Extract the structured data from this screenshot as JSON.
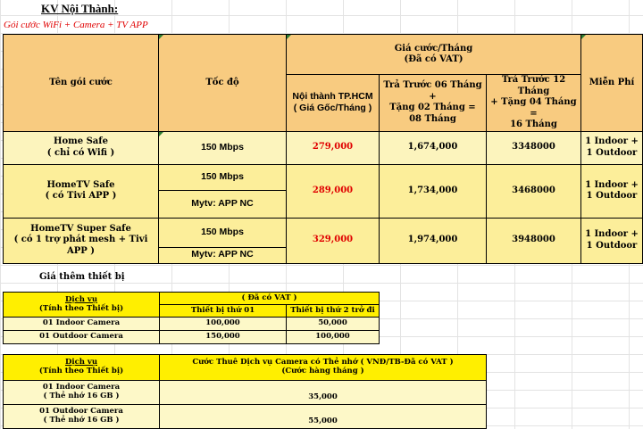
{
  "title": "KV Nội Thành:",
  "subtitle": "Gói cước WiFi + Camera + TV APP",
  "main_table": {
    "headers": {
      "package": "Tên gói cước",
      "speed": "Tốc độ",
      "price_group_line1": "Giá cước/Tháng",
      "price_group_line2": "(Đã có VAT)",
      "col_base_line1": "Nội thành TP.HCM",
      "col_base_line2": "( Giá Gốc/Tháng )",
      "col_6m_line1": "Trả Trước 06 Tháng +",
      "col_6m_line2": "Tặng 02 Tháng =",
      "col_6m_line3": "08 Tháng",
      "col_12m_line1": "Trả Trước 12 Tháng",
      "col_12m_line2": "+ Tặng 04 Tháng =",
      "col_12m_line3": "16 Tháng",
      "free": "Miễn Phí"
    },
    "rows": [
      {
        "name_line1": "Home Safe",
        "name_line2": "( chỉ có Wifi )",
        "speed": "150 Mbps",
        "tv": "",
        "base_price": "279,000",
        "prepay_6": "1,674,000",
        "prepay_12": "3348000",
        "free_line1": "1 Indoor +",
        "free_line2": "1 Outdoor"
      },
      {
        "name_line1": "HomeTV Safe",
        "name_line2": "( có Tivi APP )",
        "speed": "150 Mbps",
        "tv": "Mytv: APP NC",
        "base_price": "289,000",
        "prepay_6": "1,734,000",
        "prepay_12": "3468000",
        "free_line1": "1 Indoor +",
        "free_line2": "1 Outdoor"
      },
      {
        "name_line1": "HomeTV Super Safe",
        "name_line2": "( có 1 trợ phát mesh + Tivi APP )",
        "speed": "150 Mbps",
        "tv": "Mytv: APP NC",
        "base_price": "329,000",
        "prepay_6": "1,974,000",
        "prepay_12": "3948000",
        "free_line1": "1 Indoor +",
        "free_line2": "1 Outdoor"
      }
    ]
  },
  "extra_label": "Giá thêm thiết bị",
  "device_table": {
    "service_line1": "Dịch vụ",
    "service_line2": "(Tính theo Thiết bị)",
    "vat": "( Đã có VAT )",
    "first": "Thiết bị thứ 01",
    "second": "Thiết bị thứ 2 trở đi",
    "rows": [
      {
        "name": "01 Indoor Camera",
        "first": "100,000",
        "second": "50,000"
      },
      {
        "name": "01 Outdoor Camera",
        "first": "150,000",
        "second": "100,000"
      }
    ]
  },
  "storage_table": {
    "service_line1": "Dịch vụ",
    "service_line2": "(Tính theo Thiết bị)",
    "header_line1": "Cước Thuê Dịch vụ Camera có Thẻ nhớ ( VNĐ/TB-Đã có VAT )",
    "header_line2": "(Cước hàng tháng )",
    "rows": [
      {
        "name_line1": "01 Indoor Camera",
        "name_line2": "( Thẻ nhớ 16 GB )",
        "price": "35,000"
      },
      {
        "name_line1": "01 Outdoor Camera",
        "name_line2": "( Thẻ nhớ 16 GB )",
        "price": "55,000"
      }
    ]
  },
  "colors": {
    "header_orange": "#f8cb80",
    "row_light": "#fcf4bd",
    "row_yellow": "#fcee9a",
    "price_red": "#e00000",
    "bright_yellow": "#ffef00"
  }
}
